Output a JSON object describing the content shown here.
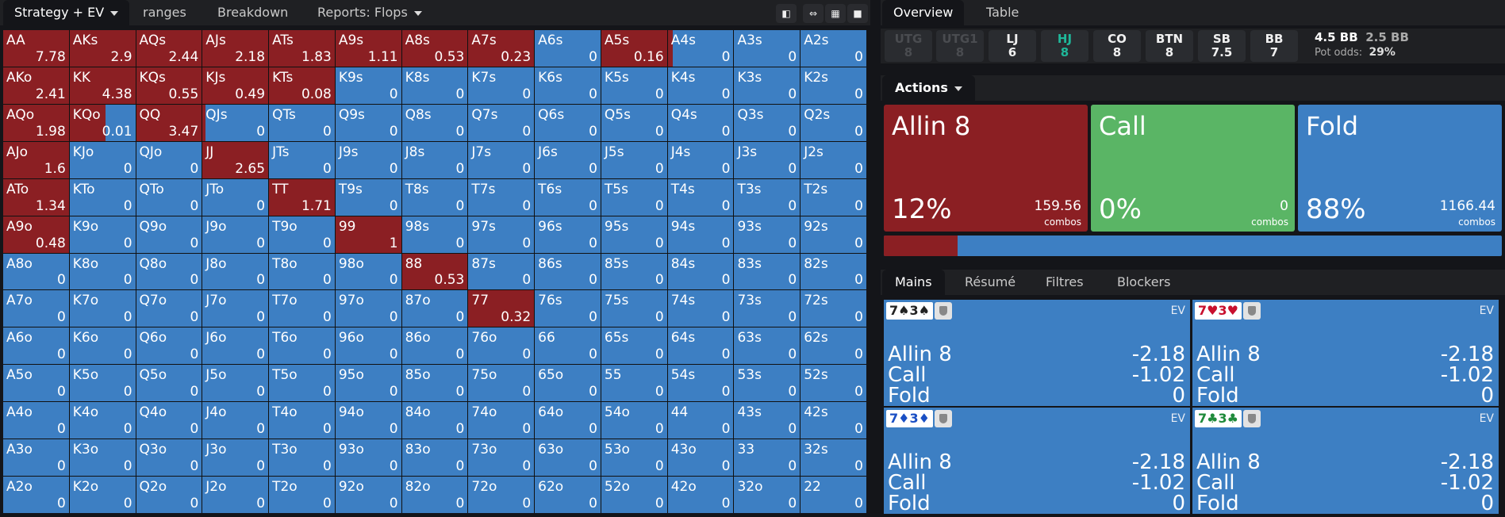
{
  "top_tabs": {
    "strategy": "Strategy + EV",
    "ranges": "ranges",
    "breakdown": "Breakdown",
    "reports": "Reports: Flops"
  },
  "toolbar_icons": [
    "contrast-icon",
    "compress-icon",
    "grid-icon",
    "square-icon"
  ],
  "grid": {
    "cells": [
      [
        {
          "n": "AA",
          "ev": "7.78",
          "r": 1
        },
        {
          "n": "AKs",
          "ev": "2.9",
          "r": 1
        },
        {
          "n": "AQs",
          "ev": "2.44",
          "r": 1
        },
        {
          "n": "AJs",
          "ev": "2.18",
          "r": 1
        },
        {
          "n": "ATs",
          "ev": "1.83",
          "r": 1
        },
        {
          "n": "A9s",
          "ev": "1.11",
          "r": 1
        },
        {
          "n": "A8s",
          "ev": "0.53",
          "r": 1
        },
        {
          "n": "A7s",
          "ev": "0.23",
          "r": 1
        },
        {
          "n": "A6s",
          "ev": "0",
          "r": 0
        },
        {
          "n": "A5s",
          "ev": "0.16",
          "r": 1
        },
        {
          "n": "A4s",
          "ev": "0",
          "r": 0.08
        },
        {
          "n": "A3s",
          "ev": "0",
          "r": 0
        },
        {
          "n": "A2s",
          "ev": "0",
          "r": 0
        }
      ],
      [
        {
          "n": "AKo",
          "ev": "2.41",
          "r": 1
        },
        {
          "n": "KK",
          "ev": "4.38",
          "r": 1
        },
        {
          "n": "KQs",
          "ev": "0.55",
          "r": 1
        },
        {
          "n": "KJs",
          "ev": "0.49",
          "r": 1
        },
        {
          "n": "KTs",
          "ev": "0.08",
          "r": 1
        },
        {
          "n": "K9s",
          "ev": "0",
          "r": 0
        },
        {
          "n": "K8s",
          "ev": "0",
          "r": 0
        },
        {
          "n": "K7s",
          "ev": "0",
          "r": 0
        },
        {
          "n": "K6s",
          "ev": "0",
          "r": 0
        },
        {
          "n": "K5s",
          "ev": "0",
          "r": 0
        },
        {
          "n": "K4s",
          "ev": "0",
          "r": 0
        },
        {
          "n": "K3s",
          "ev": "0",
          "r": 0
        },
        {
          "n": "K2s",
          "ev": "0",
          "r": 0
        }
      ],
      [
        {
          "n": "AQo",
          "ev": "1.98",
          "r": 1
        },
        {
          "n": "KQo",
          "ev": "0.01",
          "r": 0.55
        },
        {
          "n": "QQ",
          "ev": "3.47",
          "r": 1
        },
        {
          "n": "QJs",
          "ev": "0",
          "r": 0.05
        },
        {
          "n": "QTs",
          "ev": "0",
          "r": 0
        },
        {
          "n": "Q9s",
          "ev": "0",
          "r": 0
        },
        {
          "n": "Q8s",
          "ev": "0",
          "r": 0
        },
        {
          "n": "Q7s",
          "ev": "0",
          "r": 0
        },
        {
          "n": "Q6s",
          "ev": "0",
          "r": 0
        },
        {
          "n": "Q5s",
          "ev": "0",
          "r": 0
        },
        {
          "n": "Q4s",
          "ev": "0",
          "r": 0
        },
        {
          "n": "Q3s",
          "ev": "0",
          "r": 0
        },
        {
          "n": "Q2s",
          "ev": "0",
          "r": 0
        }
      ],
      [
        {
          "n": "AJo",
          "ev": "1.6",
          "r": 1
        },
        {
          "n": "KJo",
          "ev": "0",
          "r": 0
        },
        {
          "n": "QJo",
          "ev": "0",
          "r": 0
        },
        {
          "n": "JJ",
          "ev": "2.65",
          "r": 1
        },
        {
          "n": "JTs",
          "ev": "0",
          "r": 0
        },
        {
          "n": "J9s",
          "ev": "0",
          "r": 0
        },
        {
          "n": "J8s",
          "ev": "0",
          "r": 0
        },
        {
          "n": "J7s",
          "ev": "0",
          "r": 0
        },
        {
          "n": "J6s",
          "ev": "0",
          "r": 0
        },
        {
          "n": "J5s",
          "ev": "0",
          "r": 0
        },
        {
          "n": "J4s",
          "ev": "0",
          "r": 0
        },
        {
          "n": "J3s",
          "ev": "0",
          "r": 0
        },
        {
          "n": "J2s",
          "ev": "0",
          "r": 0
        }
      ],
      [
        {
          "n": "ATo",
          "ev": "1.34",
          "r": 1
        },
        {
          "n": "KTo",
          "ev": "0",
          "r": 0
        },
        {
          "n": "QTo",
          "ev": "0",
          "r": 0
        },
        {
          "n": "JTo",
          "ev": "0",
          "r": 0
        },
        {
          "n": "TT",
          "ev": "1.71",
          "r": 1
        },
        {
          "n": "T9s",
          "ev": "0",
          "r": 0
        },
        {
          "n": "T8s",
          "ev": "0",
          "r": 0
        },
        {
          "n": "T7s",
          "ev": "0",
          "r": 0
        },
        {
          "n": "T6s",
          "ev": "0",
          "r": 0
        },
        {
          "n": "T5s",
          "ev": "0",
          "r": 0
        },
        {
          "n": "T4s",
          "ev": "0",
          "r": 0
        },
        {
          "n": "T3s",
          "ev": "0",
          "r": 0
        },
        {
          "n": "T2s",
          "ev": "0",
          "r": 0
        }
      ],
      [
        {
          "n": "A9o",
          "ev": "0.48",
          "r": 1
        },
        {
          "n": "K9o",
          "ev": "0",
          "r": 0
        },
        {
          "n": "Q9o",
          "ev": "0",
          "r": 0
        },
        {
          "n": "J9o",
          "ev": "0",
          "r": 0
        },
        {
          "n": "T9o",
          "ev": "0",
          "r": 0
        },
        {
          "n": "99",
          "ev": "1",
          "r": 1
        },
        {
          "n": "98s",
          "ev": "0",
          "r": 0
        },
        {
          "n": "97s",
          "ev": "0",
          "r": 0
        },
        {
          "n": "96s",
          "ev": "0",
          "r": 0
        },
        {
          "n": "95s",
          "ev": "0",
          "r": 0
        },
        {
          "n": "94s",
          "ev": "0",
          "r": 0
        },
        {
          "n": "93s",
          "ev": "0",
          "r": 0
        },
        {
          "n": "92s",
          "ev": "0",
          "r": 0
        }
      ],
      [
        {
          "n": "A8o",
          "ev": "0",
          "r": 0
        },
        {
          "n": "K8o",
          "ev": "0",
          "r": 0
        },
        {
          "n": "Q8o",
          "ev": "0",
          "r": 0
        },
        {
          "n": "J8o",
          "ev": "0",
          "r": 0
        },
        {
          "n": "T8o",
          "ev": "0",
          "r": 0
        },
        {
          "n": "98o",
          "ev": "0",
          "r": 0
        },
        {
          "n": "88",
          "ev": "0.53",
          "r": 1
        },
        {
          "n": "87s",
          "ev": "0",
          "r": 0
        },
        {
          "n": "86s",
          "ev": "0",
          "r": 0
        },
        {
          "n": "85s",
          "ev": "0",
          "r": 0
        },
        {
          "n": "84s",
          "ev": "0",
          "r": 0
        },
        {
          "n": "83s",
          "ev": "0",
          "r": 0
        },
        {
          "n": "82s",
          "ev": "0",
          "r": 0
        }
      ],
      [
        {
          "n": "A7o",
          "ev": "0",
          "r": 0
        },
        {
          "n": "K7o",
          "ev": "0",
          "r": 0
        },
        {
          "n": "Q7o",
          "ev": "0",
          "r": 0
        },
        {
          "n": "J7o",
          "ev": "0",
          "r": 0
        },
        {
          "n": "T7o",
          "ev": "0",
          "r": 0
        },
        {
          "n": "97o",
          "ev": "0",
          "r": 0
        },
        {
          "n": "87o",
          "ev": "0",
          "r": 0
        },
        {
          "n": "77",
          "ev": "0.32",
          "r": 1
        },
        {
          "n": "76s",
          "ev": "0",
          "r": 0
        },
        {
          "n": "75s",
          "ev": "0",
          "r": 0
        },
        {
          "n": "74s",
          "ev": "0",
          "r": 0
        },
        {
          "n": "73s",
          "ev": "0",
          "r": 0
        },
        {
          "n": "72s",
          "ev": "0",
          "r": 0
        }
      ],
      [
        {
          "n": "A6o",
          "ev": "0",
          "r": 0
        },
        {
          "n": "K6o",
          "ev": "0",
          "r": 0
        },
        {
          "n": "Q6o",
          "ev": "0",
          "r": 0
        },
        {
          "n": "J6o",
          "ev": "0",
          "r": 0
        },
        {
          "n": "T6o",
          "ev": "0",
          "r": 0
        },
        {
          "n": "96o",
          "ev": "0",
          "r": 0
        },
        {
          "n": "86o",
          "ev": "0",
          "r": 0
        },
        {
          "n": "76o",
          "ev": "0",
          "r": 0
        },
        {
          "n": "66",
          "ev": "0",
          "r": 0
        },
        {
          "n": "65s",
          "ev": "0",
          "r": 0
        },
        {
          "n": "64s",
          "ev": "0",
          "r": 0
        },
        {
          "n": "63s",
          "ev": "0",
          "r": 0
        },
        {
          "n": "62s",
          "ev": "0",
          "r": 0
        }
      ],
      [
        {
          "n": "A5o",
          "ev": "0",
          "r": 0
        },
        {
          "n": "K5o",
          "ev": "0",
          "r": 0
        },
        {
          "n": "Q5o",
          "ev": "0",
          "r": 0
        },
        {
          "n": "J5o",
          "ev": "0",
          "r": 0
        },
        {
          "n": "T5o",
          "ev": "0",
          "r": 0
        },
        {
          "n": "95o",
          "ev": "0",
          "r": 0
        },
        {
          "n": "85o",
          "ev": "0",
          "r": 0
        },
        {
          "n": "75o",
          "ev": "0",
          "r": 0
        },
        {
          "n": "65o",
          "ev": "0",
          "r": 0
        },
        {
          "n": "55",
          "ev": "0",
          "r": 0
        },
        {
          "n": "54s",
          "ev": "0",
          "r": 0
        },
        {
          "n": "53s",
          "ev": "0",
          "r": 0
        },
        {
          "n": "52s",
          "ev": "0",
          "r": 0
        }
      ],
      [
        {
          "n": "A4o",
          "ev": "0",
          "r": 0
        },
        {
          "n": "K4o",
          "ev": "0",
          "r": 0
        },
        {
          "n": "Q4o",
          "ev": "0",
          "r": 0
        },
        {
          "n": "J4o",
          "ev": "0",
          "r": 0
        },
        {
          "n": "T4o",
          "ev": "0",
          "r": 0
        },
        {
          "n": "94o",
          "ev": "0",
          "r": 0
        },
        {
          "n": "84o",
          "ev": "0",
          "r": 0
        },
        {
          "n": "74o",
          "ev": "0",
          "r": 0
        },
        {
          "n": "64o",
          "ev": "0",
          "r": 0
        },
        {
          "n": "54o",
          "ev": "0",
          "r": 0
        },
        {
          "n": "44",
          "ev": "0",
          "r": 0
        },
        {
          "n": "43s",
          "ev": "0",
          "r": 0
        },
        {
          "n": "42s",
          "ev": "0",
          "r": 0
        }
      ],
      [
        {
          "n": "A3o",
          "ev": "0",
          "r": 0
        },
        {
          "n": "K3o",
          "ev": "0",
          "r": 0
        },
        {
          "n": "Q3o",
          "ev": "0",
          "r": 0
        },
        {
          "n": "J3o",
          "ev": "0",
          "r": 0
        },
        {
          "n": "T3o",
          "ev": "0",
          "r": 0
        },
        {
          "n": "93o",
          "ev": "0",
          "r": 0
        },
        {
          "n": "83o",
          "ev": "0",
          "r": 0
        },
        {
          "n": "73o",
          "ev": "0",
          "r": 0
        },
        {
          "n": "63o",
          "ev": "0",
          "r": 0
        },
        {
          "n": "53o",
          "ev": "0",
          "r": 0
        },
        {
          "n": "43o",
          "ev": "0",
          "r": 0
        },
        {
          "n": "33",
          "ev": "0",
          "r": 0
        },
        {
          "n": "32s",
          "ev": "0",
          "r": 0
        }
      ],
      [
        {
          "n": "A2o",
          "ev": "0",
          "r": 0
        },
        {
          "n": "K2o",
          "ev": "0",
          "r": 0
        },
        {
          "n": "Q2o",
          "ev": "0",
          "r": 0
        },
        {
          "n": "J2o",
          "ev": "0",
          "r": 0
        },
        {
          "n": "T2o",
          "ev": "0",
          "r": 0
        },
        {
          "n": "92o",
          "ev": "0",
          "r": 0
        },
        {
          "n": "82o",
          "ev": "0",
          "r": 0
        },
        {
          "n": "72o",
          "ev": "0",
          "r": 0
        },
        {
          "n": "62o",
          "ev": "0",
          "r": 0
        },
        {
          "n": "52o",
          "ev": "0",
          "r": 0
        },
        {
          "n": "42o",
          "ev": "0",
          "r": 0
        },
        {
          "n": "32o",
          "ev": "0",
          "r": 0
        },
        {
          "n": "22",
          "ev": "0",
          "r": 0
        }
      ]
    ]
  },
  "right_tabs": {
    "overview": "Overview",
    "table": "Table"
  },
  "positions": [
    {
      "name": "UTG",
      "stack": "8",
      "state": "dim"
    },
    {
      "name": "UTG1",
      "stack": "8",
      "state": "dim"
    },
    {
      "name": "LJ",
      "stack": "6",
      "state": "normal"
    },
    {
      "name": "HJ",
      "stack": "8",
      "state": "highlight"
    },
    {
      "name": "CO",
      "stack": "8",
      "state": "normal"
    },
    {
      "name": "BTN",
      "stack": "8",
      "state": "normal"
    },
    {
      "name": "SB",
      "stack": "7.5",
      "state": "normal"
    },
    {
      "name": "BB",
      "stack": "7",
      "state": "normal"
    }
  ],
  "pot": {
    "bb1": "4.5 BB",
    "bb2": "2.5 BB",
    "odds_label": "Pot odds:",
    "odds_value": "29%"
  },
  "actions_label": "Actions",
  "action_cards": [
    {
      "title": "Allin 8",
      "pct": "12%",
      "combos": "159.56",
      "combos_label": "combos",
      "color": "#8b1f23"
    },
    {
      "title": "Call",
      "pct": "0%",
      "combos": "0",
      "combos_label": "combos",
      "color": "#5ab565"
    },
    {
      "title": "Fold",
      "pct": "88%",
      "combos": "1166.44",
      "combos_label": "combos",
      "color": "#3d7fc3"
    }
  ],
  "allin_share": 0.12,
  "content_tabs": {
    "mains": "Mains",
    "resume": "Résumé",
    "filtres": "Filtres",
    "blockers": "Blockers"
  },
  "hands": [
    {
      "cards": "7♠3♠",
      "suit_color": "#222222",
      "ev_label": "EV",
      "rows": [
        {
          "a": "Allin 8",
          "v": "-2.18"
        },
        {
          "a": "Call",
          "v": "-1.02"
        },
        {
          "a": "Fold",
          "v": "0"
        }
      ]
    },
    {
      "cards": "7♥3♥",
      "suit_color": "#c8102e",
      "ev_label": "EV",
      "rows": [
        {
          "a": "Allin 8",
          "v": "-2.18"
        },
        {
          "a": "Call",
          "v": "-1.02"
        },
        {
          "a": "Fold",
          "v": "0"
        }
      ]
    },
    {
      "cards": "7♦3♦",
      "suit_color": "#1a4fc4",
      "ev_label": "EV",
      "rows": [
        {
          "a": "Allin 8",
          "v": "-2.18"
        },
        {
          "a": "Call",
          "v": "-1.02"
        },
        {
          "a": "Fold",
          "v": "0"
        }
      ]
    },
    {
      "cards": "7♣3♣",
      "suit_color": "#1f8a3b",
      "ev_label": "EV",
      "rows": [
        {
          "a": "Allin 8",
          "v": "-2.18"
        },
        {
          "a": "Call",
          "v": "-1.02"
        },
        {
          "a": "Fold",
          "v": "0"
        }
      ]
    }
  ]
}
